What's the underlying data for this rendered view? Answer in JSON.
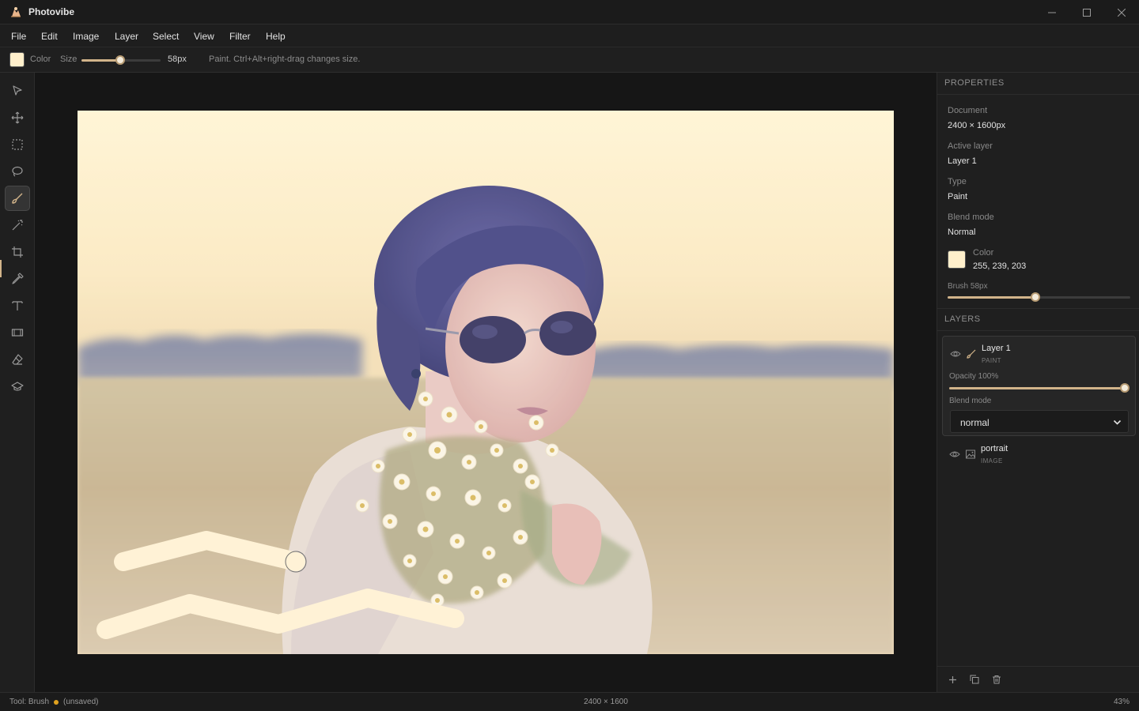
{
  "app": {
    "title": "Photovibe"
  },
  "menu": [
    "File",
    "Edit",
    "Image",
    "Layer",
    "Select",
    "View",
    "Filter",
    "Help"
  ],
  "options": {
    "color_label": "Color",
    "color_hex": "#ffefcb",
    "size_label": "Size",
    "size_value": "58px",
    "size_fraction": 0.49,
    "hint": "Paint. Ctrl+Alt+right-drag changes size."
  },
  "tools": [
    {
      "name": "select-arrow-icon"
    },
    {
      "name": "move-icon"
    },
    {
      "name": "marquee-icon"
    },
    {
      "name": "lasso-icon"
    },
    {
      "name": "brush-icon",
      "active": true
    },
    {
      "name": "magic-wand-icon"
    },
    {
      "name": "crop-icon"
    },
    {
      "name": "eyedropper-icon"
    },
    {
      "name": "text-icon"
    },
    {
      "name": "filmstrip-icon"
    },
    {
      "name": "eraser-icon"
    },
    {
      "name": "smudge-icon"
    }
  ],
  "properties": {
    "heading": "PROPERTIES",
    "document_label": "Document",
    "document_value": "2400 × 1600px",
    "active_layer_label": "Active layer",
    "active_layer_value": "Layer 1",
    "type_label": "Type",
    "type_value": "Paint",
    "blend_label": "Blend mode",
    "blend_value": "Normal",
    "color_label": "Color",
    "color_value": "255, 239, 203",
    "color_hex": "#ffefcb",
    "brush_label": "Brush 58px",
    "brush_fraction": 0.48
  },
  "layers": {
    "heading": "LAYERS",
    "items": [
      {
        "name": "Layer 1",
        "type": "PAINT",
        "opacity_label": "Opacity 100%",
        "opacity_fraction": 1.0,
        "blend_label": "Blend mode",
        "blend_value": "normal"
      },
      {
        "name": "portrait",
        "type": "IMAGE"
      }
    ]
  },
  "status": {
    "tool": "Tool: Brush",
    "saved": "(unsaved)",
    "dimensions": "2400 × 1600",
    "zoom": "43%"
  },
  "colors": {
    "accent": "#d2b48a",
    "unsaved_dot": "#e0a21f",
    "paint": "#fff2d6"
  }
}
